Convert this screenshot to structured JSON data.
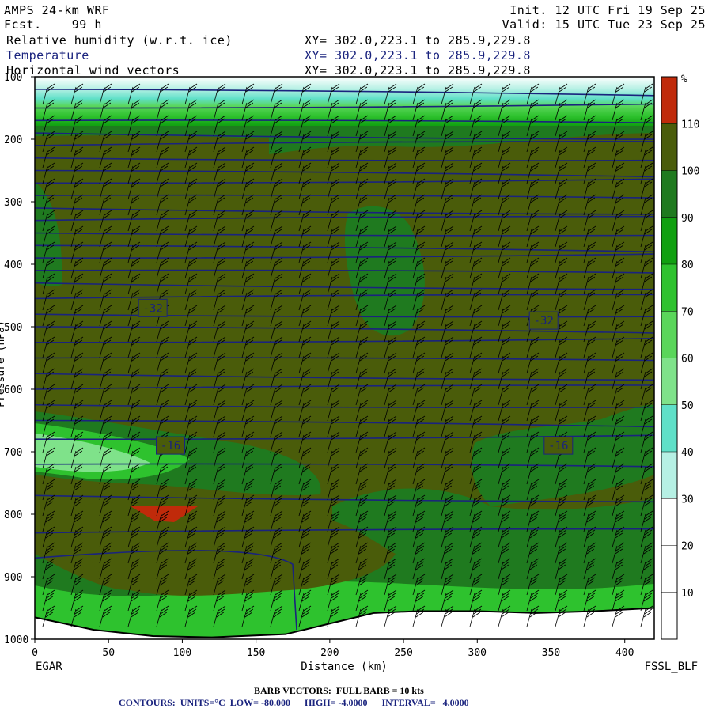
{
  "header": {
    "model": "AMPS 24-km WRF",
    "fcst": "Fcst.    99 h",
    "init": "Init. 12 UTC Fri 19 Sep 25",
    "valid": "Valid: 15 UTC Tue 23 Sep 25",
    "fields": [
      {
        "name": "Relative humidity (w.r.t. ice)",
        "xy": "XY= 302.0,223.1 to 285.9,229.8",
        "color": "#000000"
      },
      {
        "name": "Temperature",
        "xy": "XY= 302.0,223.1 to 285.9,229.8",
        "color": "#1a237e"
      },
      {
        "name": "Horizontal wind vectors",
        "xy": "XY= 302.0,223.1 to 285.9,229.8",
        "color": "#000000"
      }
    ]
  },
  "axes": {
    "xlabel": "Distance (km)",
    "ylabel": "Pressure (hPa)",
    "left_station": "EGAR",
    "right_station": "FSSL_BLF"
  },
  "footer": {
    "barb_note": "BARB VECTORS:  FULL BARB = 10 kts",
    "contours_note": "CONTOURS:  UNITS=°C  LOW= -80.000      HIGH= -4.0000      INTERVAL=   4.0000"
  },
  "colorbar": {
    "unit": "%",
    "ticks": [
      10,
      20,
      30,
      40,
      50,
      60,
      70,
      80,
      90,
      100,
      110
    ],
    "bands": [
      {
        "from": 0,
        "to": 30,
        "color": "#ffffff"
      },
      {
        "from": 30,
        "to": 40,
        "color": "#b6f0e4"
      },
      {
        "from": 40,
        "to": 50,
        "color": "#5fe0c8"
      },
      {
        "from": 50,
        "to": 60,
        "color": "#7fe28a"
      },
      {
        "from": 60,
        "to": 70,
        "color": "#5ad65a"
      },
      {
        "from": 70,
        "to": 80,
        "color": "#2ec22e"
      },
      {
        "from": 80,
        "to": 90,
        "color": "#10a010"
      },
      {
        "from": 90,
        "to": 100,
        "color": "#1f7a1f"
      },
      {
        "from": 100,
        "to": 110,
        "color": "#4a5c0a"
      },
      {
        "from": 110,
        "to": 120,
        "color": "#c02a0a"
      }
    ]
  },
  "chart_data": {
    "type": "heatmap",
    "title": "",
    "xlabel": "Distance (km)",
    "ylabel": "Pressure (hPa)",
    "xlim": [
      0,
      420
    ],
    "ylim": [
      1000,
      100
    ],
    "x_ticks": [
      0,
      50,
      100,
      150,
      200,
      250,
      300,
      350,
      400
    ],
    "y_ticks": [
      100,
      200,
      300,
      400,
      500,
      600,
      700,
      800,
      900,
      1000
    ],
    "temperature_contour_labels": [
      {
        "x": 80,
        "p": 470,
        "label": "-32"
      },
      {
        "x": 345,
        "p": 490,
        "label": "-32"
      },
      {
        "x": 92,
        "p": 690,
        "label": "-16"
      },
      {
        "x": 355,
        "p": 690,
        "label": "-16"
      }
    ],
    "terrain_surface": [
      {
        "x": 0,
        "p": 965
      },
      {
        "x": 40,
        "p": 985
      },
      {
        "x": 80,
        "p": 995
      },
      {
        "x": 120,
        "p": 997
      },
      {
        "x": 170,
        "p": 992
      },
      {
        "x": 200,
        "p": 975
      },
      {
        "x": 230,
        "p": 958
      },
      {
        "x": 260,
        "p": 955
      },
      {
        "x": 300,
        "p": 955
      },
      {
        "x": 340,
        "p": 958
      },
      {
        "x": 380,
        "p": 955
      },
      {
        "x": 420,
        "p": 950
      }
    ]
  }
}
